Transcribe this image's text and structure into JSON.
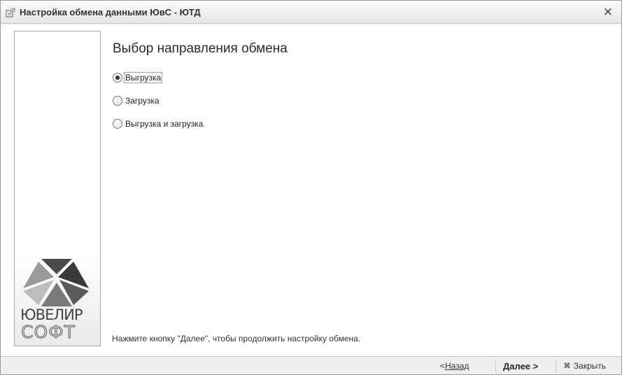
{
  "window": {
    "title": "Настройка обмена данными ЮвС - ЮТД",
    "close_glyph": "×"
  },
  "side_panel": {
    "logo_word1": "ЮВЕЛИР",
    "logo_word2": "СОФТ"
  },
  "main": {
    "heading": "Выбор направления обмена",
    "options": [
      {
        "label": "Выгрузка",
        "checked": true
      },
      {
        "label": "Загрузка",
        "checked": false
      },
      {
        "label": "Выгрузка и загрузка",
        "checked": false
      }
    ],
    "hint": "Нажмите кнопку \"Далее\", чтобы продолжить настройку обмена."
  },
  "footer": {
    "back_prefix": "< ",
    "back_label": "Назад",
    "next_label": "Далее >",
    "close_glyph": "✖",
    "close_label": "Закрыть"
  },
  "colors": {
    "logo_dark": "#4a4a4a",
    "logo_mid": "#8c8c8c",
    "logo_light": "#bdbdbd"
  }
}
